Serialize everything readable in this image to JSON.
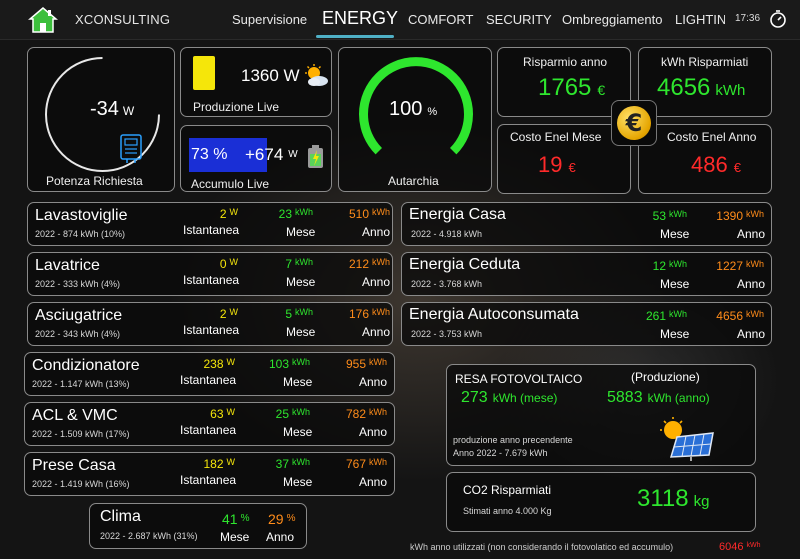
{
  "header": {
    "brand": "XCONSULTING",
    "clock": "17:36",
    "nav": [
      {
        "label": "Supervisione"
      },
      {
        "label": "ENERGY"
      },
      {
        "label": "COMFORT"
      },
      {
        "label": "SECURITY"
      },
      {
        "label": "Ombreggiamento"
      },
      {
        "label": "LIGHTING"
      }
    ],
    "active_tab": "ENERGY"
  },
  "icons": {
    "home": "home-icon",
    "timer": "timer-icon",
    "meter": "meter-icon",
    "sun_cloud": "sun-cloud-icon",
    "battery": "battery-icon",
    "euro": "euro-coin-icon",
    "solar_panel": "solar-panel-icon"
  },
  "colors": {
    "green": "#2ee62e",
    "yellow": "#f5e60a",
    "orange": "#ff8c1a",
    "red": "#ff2a2a",
    "accent": "#4fb0c6",
    "battery_blue": "#1a2fd6"
  },
  "potenza": {
    "value": "-34",
    "unit": "W",
    "label": "Potenza Richiesta"
  },
  "produzione": {
    "value": "1360 W",
    "label": "Produzione Live"
  },
  "accumulo": {
    "percent": "73 %",
    "power": "+674",
    "unit": "W",
    "label": "Accumulo Live"
  },
  "autarchia": {
    "value": "100",
    "unit": "%",
    "label": "Autarchia",
    "level_percent": 100
  },
  "risparmio_anno": {
    "label": "Risparmio anno",
    "value": "1765",
    "unit": "€"
  },
  "kwh_risparmiati": {
    "label": "kWh Risparmiati",
    "value": "4656",
    "unit": "kWh"
  },
  "costo_mese": {
    "label": "Costo Enel Mese",
    "value": "19",
    "unit": "€"
  },
  "costo_anno": {
    "label": "Costo Enel Anno",
    "value": "486",
    "unit": "€"
  },
  "col_labels": {
    "istantanea": "Istantanea",
    "mese": "Mese",
    "anno": "Anno"
  },
  "devices": [
    {
      "name": "Lavastoviglie",
      "history": "2022 - 874 kWh  (10%)",
      "inst": "2",
      "inst_unit": "W",
      "month": "23",
      "month_unit": "kWh",
      "year": "510",
      "year_unit": "kWh"
    },
    {
      "name": "Lavatrice",
      "history": "2022 - 333 kWh  (4%)",
      "inst": "0",
      "inst_unit": "W",
      "month": "7",
      "month_unit": "kWh",
      "year": "212",
      "year_unit": "kWh"
    },
    {
      "name": "Asciugatrice",
      "history": "2022 - 343 kWh  (4%)",
      "inst": "2",
      "inst_unit": "W",
      "month": "5",
      "month_unit": "kWh",
      "year": "176",
      "year_unit": "kWh"
    },
    {
      "name": "Condizionatore",
      "history": "2022 - 1.147 kWh  (13%)",
      "inst": "238",
      "inst_unit": "W",
      "month": "103",
      "month_unit": "kWh",
      "year": "955",
      "year_unit": "kWh"
    },
    {
      "name": "ACL & VMC",
      "history": "2022 - 1.509 kWh  (17%)",
      "inst": "63",
      "inst_unit": "W",
      "month": "25",
      "month_unit": "kWh",
      "year": "782",
      "year_unit": "kWh"
    },
    {
      "name": "Prese Casa",
      "history": "2022 - 1.419 kWh  (16%)",
      "inst": "182",
      "inst_unit": "W",
      "month": "37",
      "month_unit": "kWh",
      "year": "767",
      "year_unit": "kWh"
    }
  ],
  "clima": {
    "name": "Clima",
    "history": "2022 - 2.687 kWh (31%)",
    "month": "41",
    "month_unit": "%",
    "year": "29",
    "year_unit": "%"
  },
  "energia": [
    {
      "name": "Energia Casa",
      "history": "2022 - 4.918 kWh",
      "month": "53",
      "month_unit": "kWh",
      "year": "1390",
      "year_unit": "kWh"
    },
    {
      "name": "Energia Ceduta",
      "history": "2022 - 3.768 kWh",
      "month": "12",
      "month_unit": "kWh",
      "year": "1227",
      "year_unit": "kWh"
    },
    {
      "name": "Energia Autoconsumata",
      "history": "2022 - 3.753 kWh",
      "month": "261",
      "month_unit": "kWh",
      "year": "4656",
      "year_unit": "kWh"
    }
  ],
  "resa": {
    "title": "RESA FOTOVOLTAICO",
    "subtitle": "(Produzione)",
    "month_value": "273",
    "month_unit": "kWh (mese)",
    "year_value": "5883",
    "year_unit": "kWh (anno)",
    "prev_label": "produzione anno precendente",
    "prev_value": "Anno 2022  -   7.679 kWh"
  },
  "co2": {
    "title": "CO2 Risparmiati",
    "subtitle": "Stimati anno 4.000 Kg",
    "value": "3118",
    "unit": "kg"
  },
  "footer": {
    "note": "kWh anno utilizzati (non considerando il fotovolatico ed accumulo)",
    "value": "6046",
    "unit": "kWh"
  }
}
